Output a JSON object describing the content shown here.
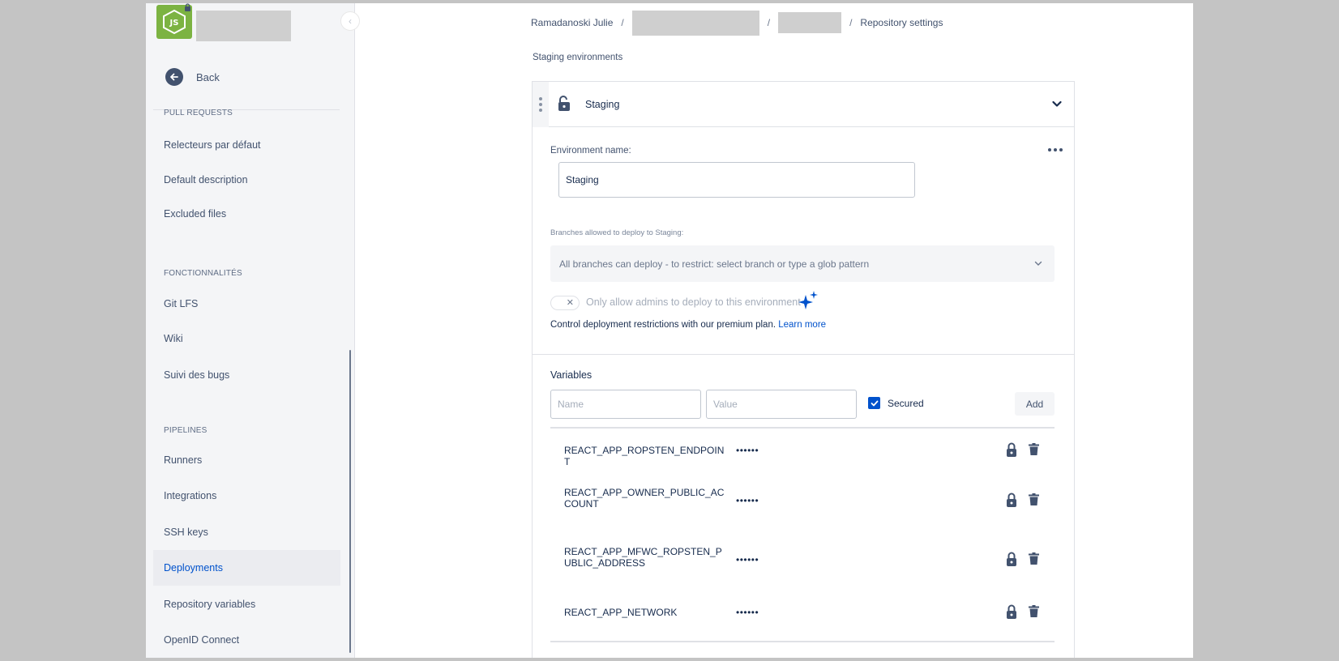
{
  "sidebar": {
    "back_label": "Back",
    "sections": {
      "pull_requests": "PULL REQUESTS",
      "features": "FONCTIONNALITÉS",
      "pipelines": "PIPELINES"
    },
    "items": {
      "default_reviewers": "Relecteurs par défaut",
      "default_description": "Default description",
      "excluded_files": "Excluded files",
      "git_lfs": "Git LFS",
      "wiki": "Wiki",
      "issue_tracker": "Suivi des bugs",
      "runners": "Runners",
      "integrations": "Integrations",
      "ssh_keys": "SSH keys",
      "deployments": "Deployments",
      "repository_variables": "Repository variables",
      "openid_connect": "OpenID Connect"
    },
    "active_item": "Deployments"
  },
  "breadcrumb": {
    "owner": "Ramadanoski Julie",
    "separator": "/",
    "current": "Repository settings"
  },
  "page": {
    "subtitle": "Staging environments"
  },
  "environment": {
    "title": "Staging",
    "name_label": "Environment name:",
    "name_value": "Staging",
    "branches_label": "Branches allowed to deploy to Staging:",
    "branches_placeholder": "All branches can deploy - to restrict: select branch or type a glob pattern",
    "admins_only_label": "Only allow admins to deploy to this environment",
    "admins_only_enabled": false,
    "premium_text": "Control deployment restrictions with our premium plan.",
    "learn_more": "Learn more"
  },
  "variables": {
    "title": "Variables",
    "name_placeholder": "Name",
    "value_placeholder": "Value",
    "secured_label": "Secured",
    "secured_checked": true,
    "add_label": "Add",
    "rows": [
      {
        "name": "REACT_APP_ROPSTEN_ENDPOINT",
        "value": "••••••"
      },
      {
        "name": "REACT_APP_OWNER_PUBLIC_ACCOUNT",
        "value": "••••••"
      },
      {
        "name": "REACT_APP_MFWC_ROPSTEN_PUBLIC_ADDRESS",
        "value": "••••••"
      },
      {
        "name": "REACT_APP_NETWORK",
        "value": "••••••"
      }
    ]
  },
  "colors": {
    "accent": "#0052cc",
    "logo_green": "#7cb342",
    "text": "#172b4d",
    "muted": "#42526e"
  }
}
